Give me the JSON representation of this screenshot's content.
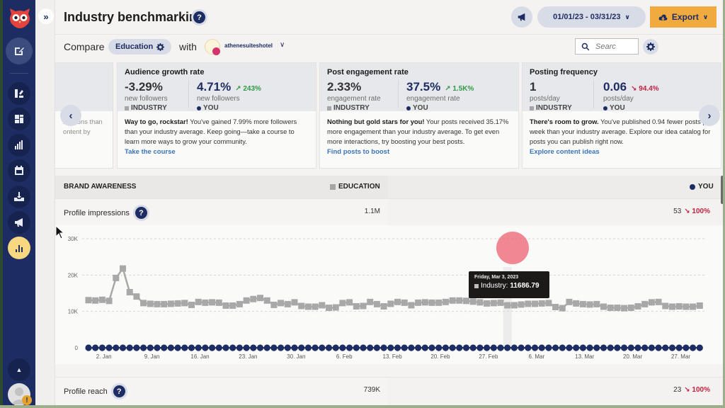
{
  "sidebar": {
    "items": [
      {
        "name": "compose",
        "icon": "compose-icon"
      },
      {
        "name": "planner",
        "icon": "streams-icon"
      },
      {
        "name": "dashboard",
        "icon": "dashboard-icon"
      },
      {
        "name": "analytics-bars",
        "icon": "analytics-icon"
      },
      {
        "name": "calendar",
        "icon": "calendar-icon"
      },
      {
        "name": "inbox",
        "icon": "inbox-icon"
      },
      {
        "name": "advertise",
        "icon": "megaphone-icon"
      },
      {
        "name": "benchmarking",
        "icon": "bar-chart-icon",
        "active": true
      }
    ],
    "collapse_up": "▲",
    "avatar_badge": "!"
  },
  "header": {
    "expand_glyph": "»",
    "title": "Industry benchmarking",
    "help": "?",
    "date_range": "01/01/23 - 03/31/23",
    "export_label": "Export",
    "chevron": "∨"
  },
  "subbar": {
    "compare_label": "Compare",
    "industry": "Education",
    "with_label": "with",
    "account": "athenesuiteshotel",
    "search_placeholder": "Searc"
  },
  "cards": [
    {
      "partial_text_1": "ressions than",
      "partial_text_2": "ontent by"
    },
    {
      "title": "Audience growth rate",
      "industry_value": "-3.29%",
      "industry_sub": "new followers",
      "industry_label": "INDUSTRY",
      "you_value": "4.71%",
      "you_sub": "new followers",
      "you_label": "YOU",
      "change": "↗ 243%",
      "change_dir": "up",
      "body_bold": "Way to go, rockstar!",
      "body": " You've gained 7.99% more followers than your industry average. Keep going—take a course to learn more ways to grow your community.",
      "link": "Take the course"
    },
    {
      "title": "Post engagement rate",
      "industry_value": "2.33%",
      "industry_sub": "engagement rate",
      "industry_label": "INDUSTRY",
      "you_value": "37.5%",
      "you_sub": "engagement rate",
      "you_label": "YOU",
      "change": "↗ 1.5K%",
      "change_dir": "up",
      "body_bold": "Nothing but gold stars for you!",
      "body": " Your posts received 35.17% more engagement than your industry average. To get even more interactions, try boosting your best posts.",
      "link": "Find posts to boost"
    },
    {
      "title": "Posting frequency",
      "industry_value": "1",
      "industry_sub": "posts/day",
      "industry_label": "INDUSTRY",
      "you_value": "0.06",
      "you_sub": "posts/day",
      "you_label": "YOU",
      "change": "↘ 94.4%",
      "change_dir": "down",
      "body_bold": "There's room to grow.",
      "body": " You've published 0.94 fewer posts per week than your industry average. Explore our idea catalog for posts you can publish right now.",
      "link": "Explore content ideas"
    }
  ],
  "carousel": {
    "prev": "‹",
    "next": "›"
  },
  "brand_awareness": {
    "title": "BRAND AWARENESS",
    "industry_col": "EDUCATION",
    "you_col": "YOU",
    "rows": [
      {
        "label": "Profile impressions",
        "industry": "1.1M",
        "you": "53",
        "change": "↘ 100%"
      },
      {
        "label": "Profile reach",
        "industry": "739K",
        "you": "23",
        "change": "↘ 100%"
      }
    ]
  },
  "tooltip": {
    "date": "Friday, Mar 3, 2023",
    "series": "Industry:",
    "value": "11686.79"
  },
  "colors": {
    "navy": "#1d2d63",
    "industry_gray": "#a6a6a6",
    "export_orange": "#f1aa3f",
    "up_green": "#2e9a47",
    "down_red": "#c0213f",
    "active_yellow": "#f7d77f"
  },
  "chart_data": {
    "type": "line",
    "title": "Profile impressions",
    "xlabel": "",
    "ylabel": "",
    "ylim": [
      0,
      30000
    ],
    "yticks": [
      0,
      10000,
      20000,
      30000
    ],
    "ytick_labels": [
      "0",
      "10K",
      "20K",
      "30K"
    ],
    "x_start": "2023-01-01",
    "x_tick_labels": [
      "2. Jan",
      "9. Jan",
      "16. Jan",
      "23. Jan",
      "30. Jan",
      "6. Feb",
      "13. Feb",
      "20. Feb",
      "27. Feb",
      "6. Mar",
      "13. Mar",
      "20. Mar",
      "27. Mar"
    ],
    "x_tick_day_index": [
      1,
      8,
      15,
      22,
      29,
      36,
      43,
      50,
      57,
      64,
      71,
      78,
      85
    ],
    "grid": true,
    "highlight_day_index": 61,
    "series": [
      {
        "name": "Industry",
        "marker": "square",
        "values": [
          13100,
          13000,
          13200,
          12900,
          19200,
          21800,
          15300,
          14100,
          12300,
          12100,
          12000,
          12000,
          12100,
          12200,
          12300,
          11800,
          12600,
          12400,
          12500,
          12400,
          11600,
          11600,
          12000,
          13000,
          13400,
          13700,
          13000,
          11800,
          12300,
          12000,
          12500,
          11500,
          11300,
          11300,
          11700,
          11000,
          11100,
          12300,
          12500,
          11400,
          11500,
          12600,
          12000,
          11400,
          12100,
          12600,
          12400,
          11700,
          12400,
          12500,
          12400,
          12400,
          12600,
          13000,
          13000,
          12900,
          12700,
          12500,
          12200,
          12300,
          12400,
          11687,
          11700,
          11900,
          12100,
          12100,
          12200,
          12300,
          11200,
          10900,
          12600,
          12200,
          12000,
          11900,
          12000,
          11300,
          11000,
          11000,
          10900,
          11000,
          11400,
          12000,
          12500,
          12600,
          11500,
          11300,
          11400,
          11300,
          11300,
          11600
        ]
      },
      {
        "name": "You",
        "marker": "circle",
        "values": [
          0,
          0,
          0,
          0,
          0,
          0,
          0,
          0,
          0,
          0,
          0,
          0,
          0,
          0,
          0,
          0,
          0,
          0,
          0,
          0,
          0,
          0,
          0,
          0,
          0,
          0,
          0,
          0,
          0,
          0,
          0,
          0,
          0,
          0,
          0,
          0,
          0,
          0,
          0,
          0,
          0,
          0,
          0,
          0,
          0,
          0,
          0,
          0,
          0,
          0,
          0,
          0,
          0,
          0,
          0,
          0,
          0,
          0,
          0,
          0,
          0,
          0,
          0,
          0,
          0,
          0,
          0,
          0,
          0,
          0,
          0,
          0,
          0,
          0,
          0,
          0,
          0,
          0,
          0,
          0,
          0,
          0,
          0,
          0,
          0,
          0,
          0,
          0,
          0,
          0
        ]
      }
    ]
  }
}
